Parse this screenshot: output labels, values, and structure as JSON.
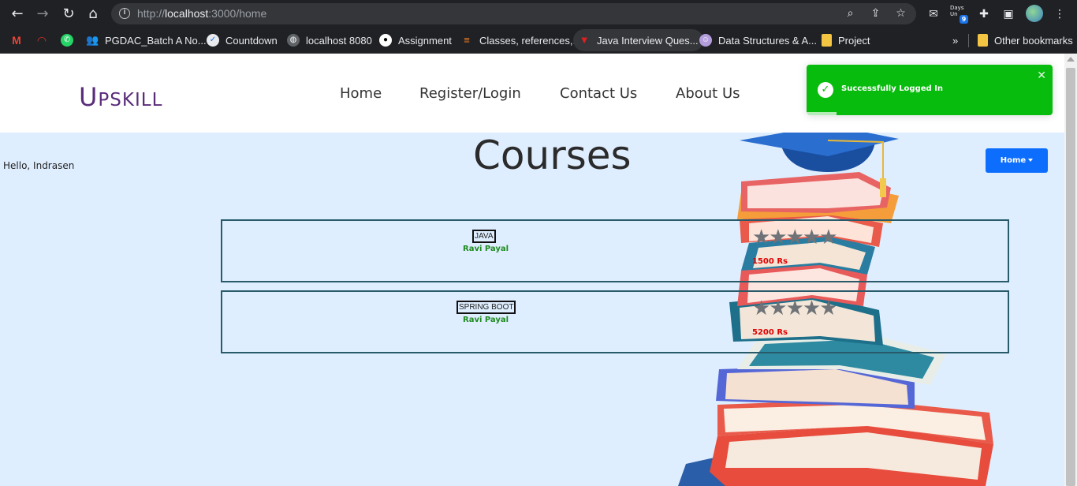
{
  "browser": {
    "url_prefix": "http://",
    "url_host": "localhost",
    "url_rest": ":3000/home",
    "days_label": "Days Un",
    "days_count": "9",
    "bookmarks": [
      {
        "label": "PGDAC_Batch A No..."
      },
      {
        "label": "Countdown"
      },
      {
        "label": "localhost 8080"
      },
      {
        "label": "Assignment"
      },
      {
        "label": "Classes, references,..."
      },
      {
        "label": "Java Interview Ques..."
      },
      {
        "label": "Data Structures & A..."
      },
      {
        "label": "Project"
      }
    ],
    "more_label": "»",
    "other_bookmarks": "Other bookmarks"
  },
  "header": {
    "logo_first": "U",
    "logo_rest": "PSKILL",
    "nav": [
      "Home",
      "Register/Login",
      "Contact Us",
      "About Us"
    ]
  },
  "toast": {
    "message": "Successfully Logged In",
    "close": "✕"
  },
  "greeting": "Hello, Indrasen",
  "page_title": "Courses",
  "dropdown_label": "Home",
  "courses": [
    {
      "name": "JAVA",
      "author": "Ravi Payal",
      "rating": 5,
      "stars": "★★★★★",
      "price": "1500 Rs"
    },
    {
      "name": "SPRING BOOT",
      "author": "Ravi Payal",
      "rating": 5,
      "stars": "★★★★★",
      "price": "5200 Rs"
    }
  ],
  "colors": {
    "brand": "#5a2d7a",
    "toast": "#07bc0c",
    "primary_button": "#0d6efd",
    "author": "#1e8a1e",
    "price": "#e00000",
    "card_border": "#285a6a",
    "page_bg": "#dfeeff"
  },
  "icons": {
    "toolbar": [
      "back-arrow-icon",
      "forward-arrow-icon",
      "reload-icon",
      "home-icon",
      "info-icon",
      "zoom-icon",
      "share-icon",
      "star-icon",
      "mail-icon",
      "puzzle-icon",
      "sidepanel-icon",
      "kebab-menu-icon"
    ],
    "toast": "check-circle-icon"
  }
}
